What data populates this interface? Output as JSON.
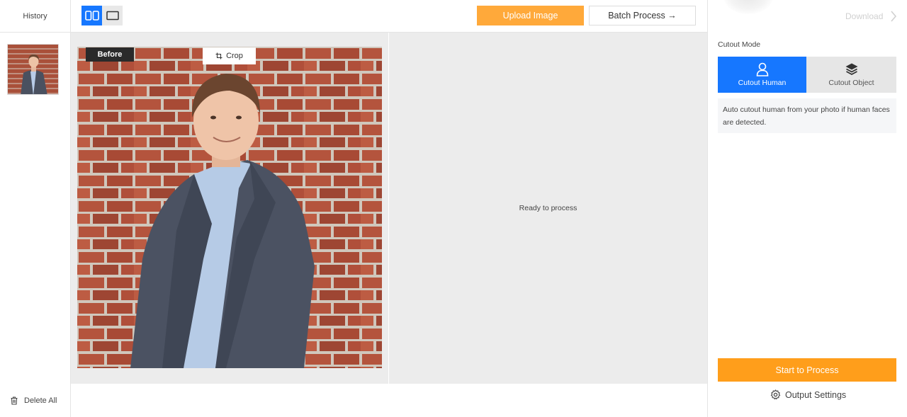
{
  "history": {
    "title": "History",
    "delete_all": "Delete All"
  },
  "toolbar": {
    "upload_label": "Upload Image",
    "batch_label": "Batch Process →"
  },
  "canvas": {
    "before_label": "Before",
    "crop_label": "Crop",
    "after_status": "Ready to process"
  },
  "panel": {
    "download_label": "Download",
    "mode_title": "Cutout Mode",
    "modes": [
      {
        "label": "Cutout Human",
        "icon": "person-icon",
        "selected": true
      },
      {
        "label": "Cutout Object",
        "icon": "layers-icon",
        "selected": false
      }
    ],
    "mode_description": "Auto cutout human from your photo if human faces are detected.",
    "start_label": "Start to Process",
    "output_settings_label": "Output Settings"
  },
  "colors": {
    "accent_blue": "#1677ff",
    "upload_orange": "#ffa93a",
    "start_orange": "#ff9e1b"
  }
}
